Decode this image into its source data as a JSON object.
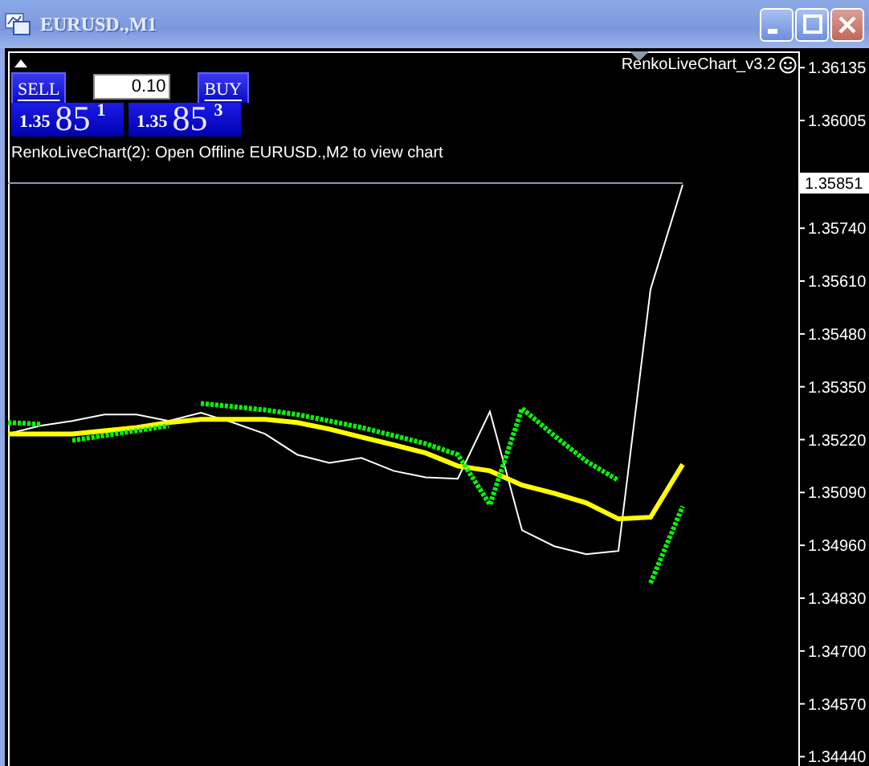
{
  "window": {
    "title": "EURUSD.,M1"
  },
  "trade_panel": {
    "sell": {
      "label": "SELL",
      "price_major": "1.35",
      "price_pips": "85",
      "price_fraction": "1"
    },
    "lot": {
      "value": "0.10"
    },
    "buy": {
      "label": "BUY",
      "price_major": "1.35",
      "price_pips": "85",
      "price_fraction": "3"
    }
  },
  "indicator_label": "RenkoLiveChart_v3.2",
  "message": "RenkoLiveChart(2): Open Offline EURUSD.,M2 to view chart",
  "chart": {
    "chart_data": {
      "type": "line",
      "categories": [
        null,
        null,
        null,
        null,
        null,
        null,
        null,
        null,
        null,
        null,
        null,
        null,
        null,
        null,
        null,
        null,
        null,
        null,
        null,
        null,
        null,
        null
      ],
      "ylim": [
        1.34425,
        1.36175
      ],
      "yticks": [
        {
          "value": 1.36135,
          "label": "1.36135"
        },
        {
          "value": 1.36005,
          "label": "1.36005"
        },
        {
          "value": 1.3574,
          "label": "1.35740"
        },
        {
          "value": 1.3561,
          "label": "1.35610"
        },
        {
          "value": 1.3548,
          "label": "1.35480"
        },
        {
          "value": 1.3535,
          "label": "1.35350"
        },
        {
          "value": 1.3522,
          "label": "1.35220"
        },
        {
          "value": 1.3509,
          "label": "1.35090"
        },
        {
          "value": 1.3496,
          "label": "1.34960"
        },
        {
          "value": 1.3483,
          "label": "1.34830"
        },
        {
          "value": 1.347,
          "label": "1.34700"
        },
        {
          "value": 1.3457,
          "label": "1.34570"
        },
        {
          "value": 1.3444,
          "label": "1.34440"
        }
      ],
      "series": [
        {
          "color": "#ffffff",
          "values": [
            1.35234,
            1.35254,
            1.35266,
            1.35282,
            1.35282,
            1.35266,
            1.35286,
            1.35262,
            1.35234,
            1.35183,
            1.35163,
            1.35175,
            1.35143,
            1.35127,
            1.35124,
            1.35289,
            1.34997,
            1.34958,
            1.34938,
            1.34946,
            1.3559,
            1.35847
          ]
        },
        {
          "color": "#ffff00",
          "values": [
            1.35234,
            1.35234,
            1.35234,
            1.35242,
            1.3525,
            1.35262,
            1.3527,
            1.3527,
            1.3527,
            1.35262,
            1.35246,
            1.35226,
            1.35207,
            1.35187,
            1.35155,
            1.35143,
            1.35108,
            1.35088,
            1.35064,
            1.35025,
            1.35029,
            1.35159
          ]
        },
        {
          "color": "#00ff00",
          "line_style": "dotted",
          "values": [
            1.35262,
            1.35258,
            null,
            null,
            null,
            null,
            1.35309,
            1.35301,
            1.35293,
            1.35282,
            1.35266,
            1.3525,
            1.3523,
            1.3521,
            1.35183,
            1.3506,
            1.35297,
            1.3523,
            1.35167,
            1.3512,
            null,
            null
          ]
        },
        {
          "color": "#00ff00",
          "line_style": "dotted",
          "values": [
            null,
            null,
            1.35218,
            1.3523,
            1.35242,
            1.35254,
            null,
            null,
            null,
            null,
            null,
            null,
            null,
            null,
            null,
            null,
            null,
            null,
            null,
            null,
            1.34867,
            1.35056
          ]
        },
        {
          "color": "#8c9aa8",
          "values": [
            1.35851,
            1.35851,
            1.35851,
            1.35851,
            1.35851,
            1.35851,
            1.35851,
            1.35851,
            1.35851,
            1.35851,
            1.35851,
            1.35851,
            1.35851,
            1.35851,
            1.35851,
            1.35851,
            1.35851,
            1.35851,
            1.35851,
            1.35851,
            1.35851,
            1.35851
          ]
        }
      ]
    },
    "current_price": "1.35851"
  }
}
